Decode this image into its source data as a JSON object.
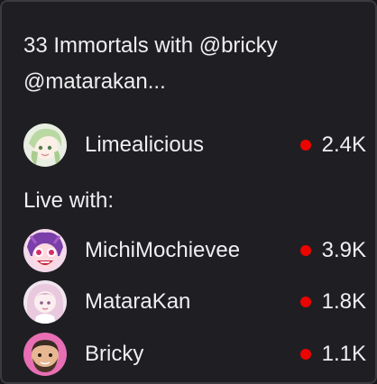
{
  "popup": {
    "title": "33 Immortals with @bricky @matarakan...",
    "host": {
      "name": "Limealicious",
      "viewers": "2.4K",
      "avatar_icon": "limealicious-avatar"
    },
    "live_with_label": "Live with:",
    "guests": [
      {
        "name": "MichiMochievee",
        "viewers": "3.9K",
        "avatar_icon": "michimochievee-avatar"
      },
      {
        "name": "MataraKan",
        "viewers": "1.8K",
        "avatar_icon": "matarakan-avatar"
      },
      {
        "name": "Bricky",
        "viewers": "1.1K",
        "avatar_icon": "bricky-avatar"
      }
    ],
    "live_color": "#eb0400"
  }
}
